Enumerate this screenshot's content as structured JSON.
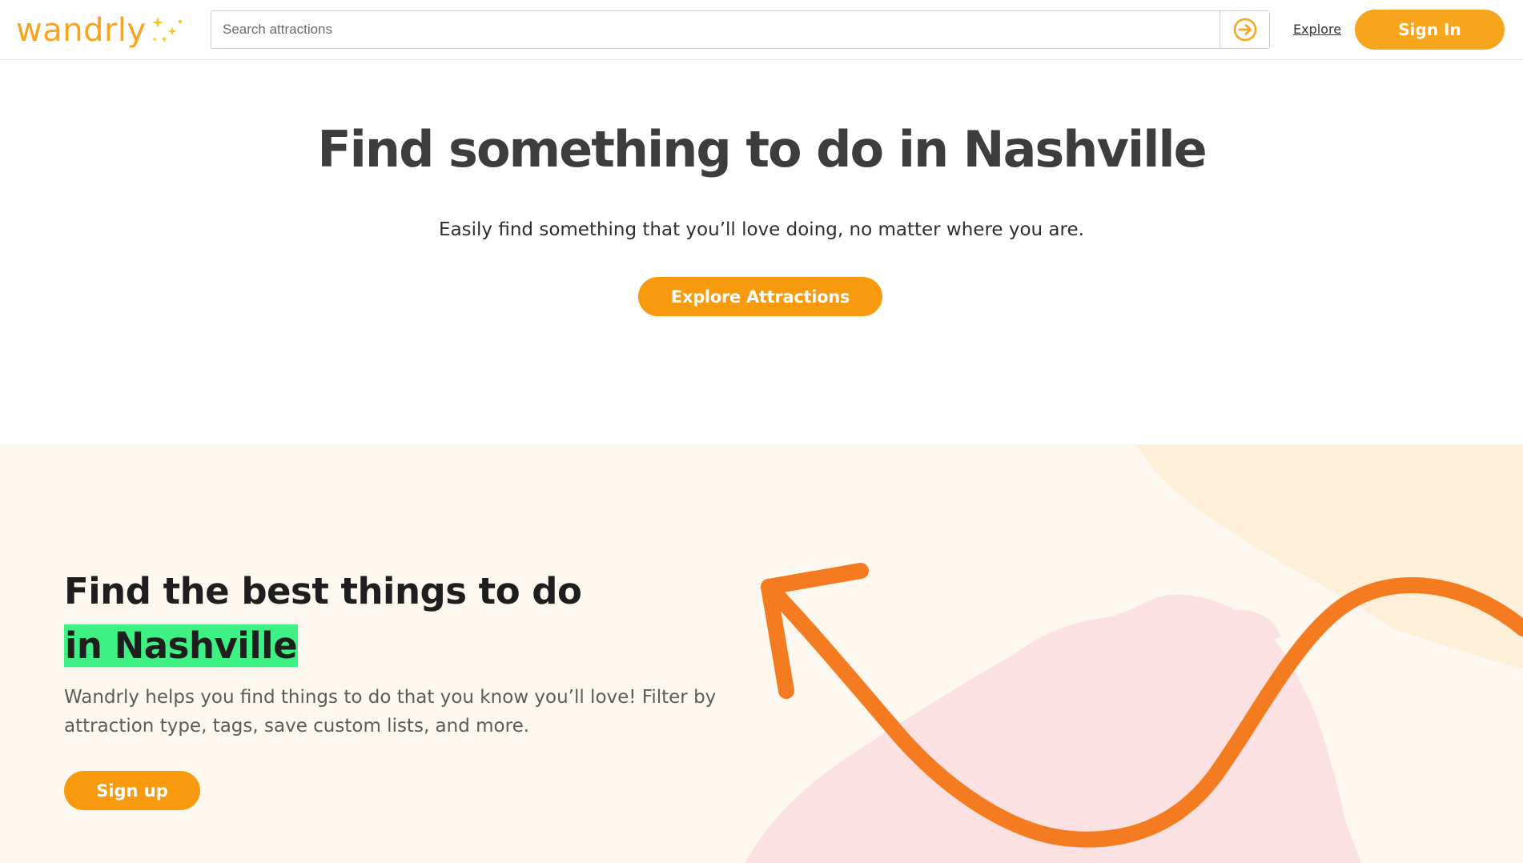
{
  "header": {
    "logo_text": "wandrly",
    "logo_icon": "sparkles-icon",
    "search_placeholder": "Search attractions",
    "search_button_icon": "arrow-right-circle-icon",
    "explore_link": "Explore",
    "signin_label": "Sign In"
  },
  "hero": {
    "title": "Find something to do in Nashville",
    "subtitle": "Easily find something that you’ll love doing, no matter where you are.",
    "cta_label": "Explore Attractions"
  },
  "promo": {
    "title_line1": "Find the best things to do",
    "title_highlight": "in Nashville",
    "description": "Wandrly helps you find things to do that you know you’ll love! Filter by attraction type, tags, save custom lists, and more.",
    "signup_label": "Sign up",
    "decoration_icon": "curved-arrow-icon"
  },
  "colors": {
    "brand": "#f7a51c",
    "button_orange": "#f89a0e",
    "arrow_orange": "#f47b20",
    "highlight_green": "#3ef184",
    "promo_background": "#fcf8f0"
  }
}
